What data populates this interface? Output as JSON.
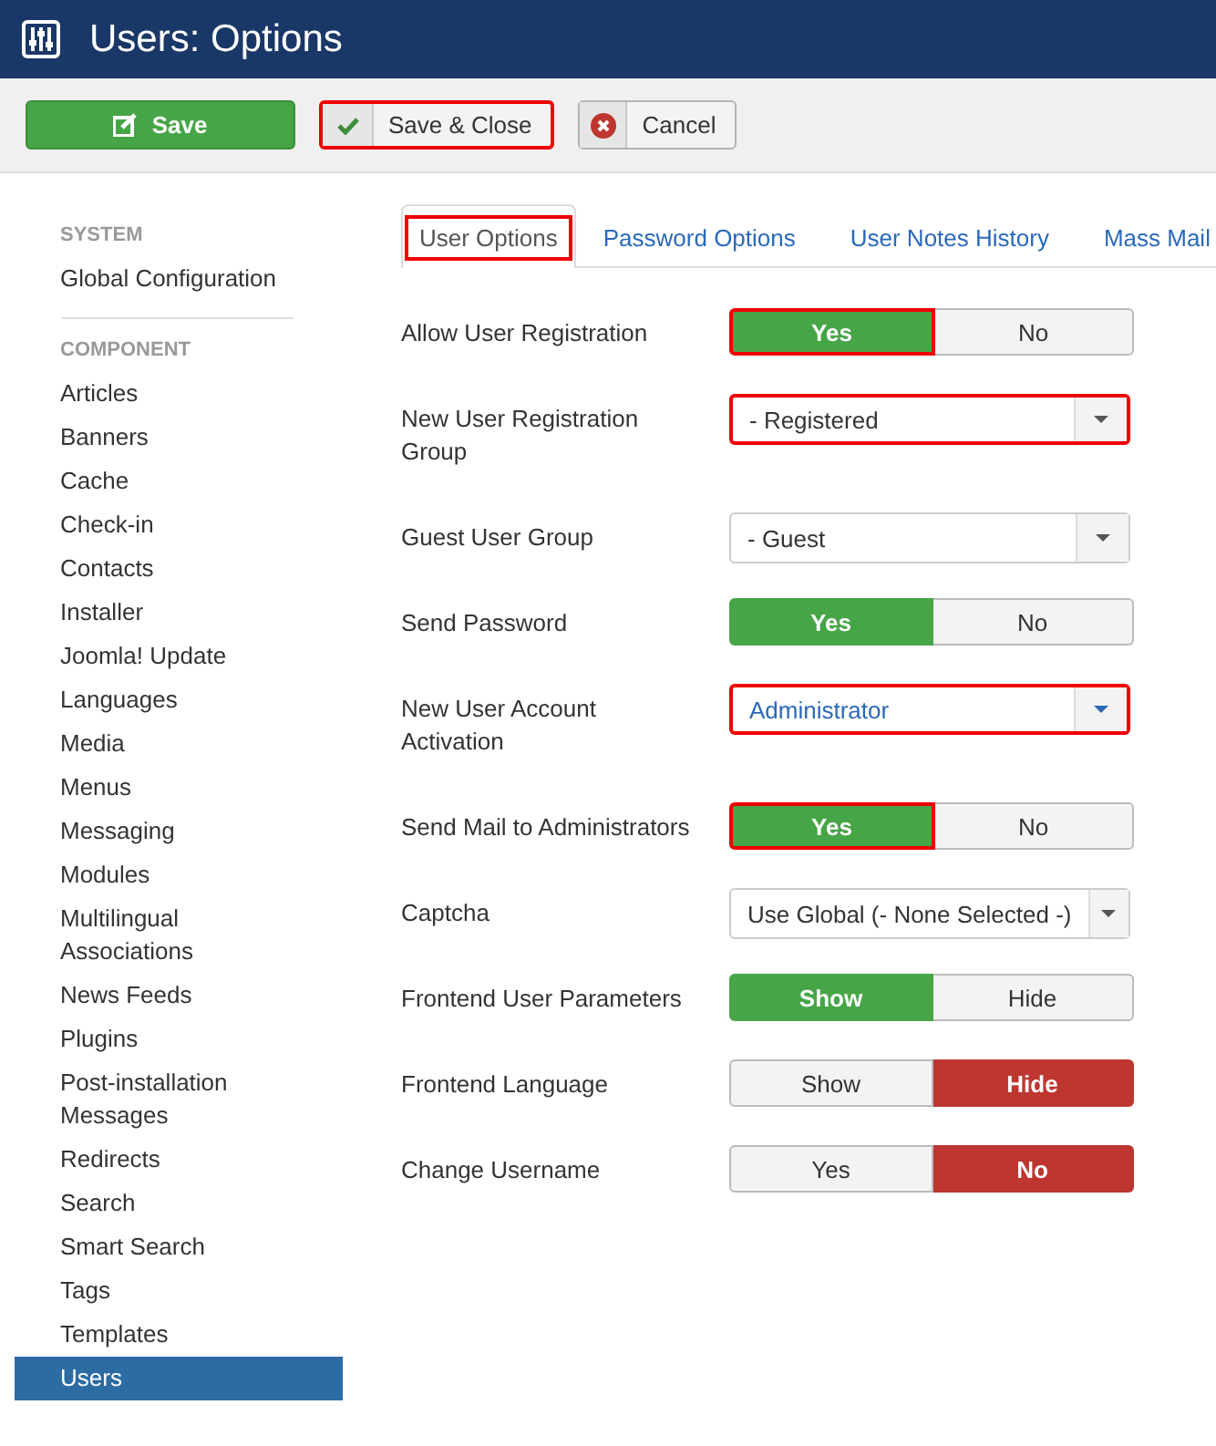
{
  "header": {
    "title": "Users: Options"
  },
  "toolbar": [
    {
      "kind": "primary",
      "label": "Save",
      "highlighted": false
    },
    {
      "kind": "check",
      "label": "Save & Close",
      "highlighted": true
    },
    {
      "kind": "cancel",
      "label": "Cancel",
      "highlighted": false
    }
  ],
  "sidebar": {
    "sections": [
      {
        "heading": "SYSTEM",
        "items": [
          {
            "label": "Global Configuration",
            "selected": false
          }
        ]
      },
      {
        "heading": "COMPONENT",
        "items": [
          {
            "label": "Articles",
            "selected": false
          },
          {
            "label": "Banners",
            "selected": false
          },
          {
            "label": "Cache",
            "selected": false
          },
          {
            "label": "Check-in",
            "selected": false
          },
          {
            "label": "Contacts",
            "selected": false
          },
          {
            "label": "Installer",
            "selected": false
          },
          {
            "label": "Joomla! Update",
            "selected": false
          },
          {
            "label": "Languages",
            "selected": false
          },
          {
            "label": "Media",
            "selected": false
          },
          {
            "label": "Menus",
            "selected": false
          },
          {
            "label": "Messaging",
            "selected": false
          },
          {
            "label": "Modules",
            "selected": false
          },
          {
            "label": "Multilingual Associations",
            "selected": false
          },
          {
            "label": "News Feeds",
            "selected": false
          },
          {
            "label": "Plugins",
            "selected": false
          },
          {
            "label": "Post-installation Messages",
            "selected": false
          },
          {
            "label": "Redirects",
            "selected": false
          },
          {
            "label": "Search",
            "selected": false
          },
          {
            "label": "Smart Search",
            "selected": false
          },
          {
            "label": "Tags",
            "selected": false
          },
          {
            "label": "Templates",
            "selected": false
          },
          {
            "label": "Users",
            "selected": true
          }
        ]
      }
    ]
  },
  "tabs": [
    {
      "label": "User Options",
      "selected": true,
      "highlighted": true
    },
    {
      "label": "Password Options",
      "selected": false,
      "highlighted": false
    },
    {
      "label": "User Notes History",
      "selected": false,
      "highlighted": false
    },
    {
      "label": "Mass Mail",
      "selected": false,
      "highlighted": false
    }
  ],
  "fields": [
    {
      "kind": "toggle",
      "label": "Allow User Registration",
      "options": [
        {
          "label": "Yes",
          "selected": true,
          "color": "#46a546",
          "highlighted": true
        },
        {
          "label": "No",
          "selected": false,
          "highlighted": false
        }
      ]
    },
    {
      "kind": "select",
      "label": "New User Registration Group",
      "value": "- Registered",
      "changed": false,
      "highlighted": true
    },
    {
      "kind": "select",
      "label": "Guest User Group",
      "value": "- Guest",
      "changed": false,
      "highlighted": false
    },
    {
      "kind": "toggle",
      "label": "Send Password",
      "options": [
        {
          "label": "Yes",
          "selected": true,
          "color": "#46a546",
          "highlighted": false
        },
        {
          "label": "No",
          "selected": false,
          "highlighted": false
        }
      ]
    },
    {
      "kind": "select",
      "label": "New User Account Activation",
      "value": "Administrator",
      "changed": true,
      "highlighted": true
    },
    {
      "kind": "toggle",
      "label": "Send Mail to Administrators",
      "options": [
        {
          "label": "Yes",
          "selected": true,
          "color": "#46a546",
          "highlighted": true
        },
        {
          "label": "No",
          "selected": false,
          "highlighted": false
        }
      ]
    },
    {
      "kind": "select",
      "label": "Captcha",
      "value": "Use Global (- None Selected -)",
      "changed": false,
      "highlighted": false
    },
    {
      "kind": "toggle",
      "label": "Frontend User Parameters",
      "options": [
        {
          "label": "Show",
          "selected": true,
          "color": "#46a546",
          "highlighted": false
        },
        {
          "label": "Hide",
          "selected": false,
          "highlighted": false
        }
      ]
    },
    {
      "kind": "toggle",
      "label": "Frontend Language",
      "options": [
        {
          "label": "Show",
          "selected": false,
          "highlighted": false
        },
        {
          "label": "Hide",
          "selected": true,
          "color": "#bd362f",
          "highlighted": false
        }
      ]
    },
    {
      "kind": "toggle",
      "label": "Change Username",
      "options": [
        {
          "label": "Yes",
          "selected": false,
          "highlighted": false
        },
        {
          "label": "No",
          "selected": true,
          "color": "#bd362f",
          "highlighted": false
        }
      ]
    }
  ]
}
